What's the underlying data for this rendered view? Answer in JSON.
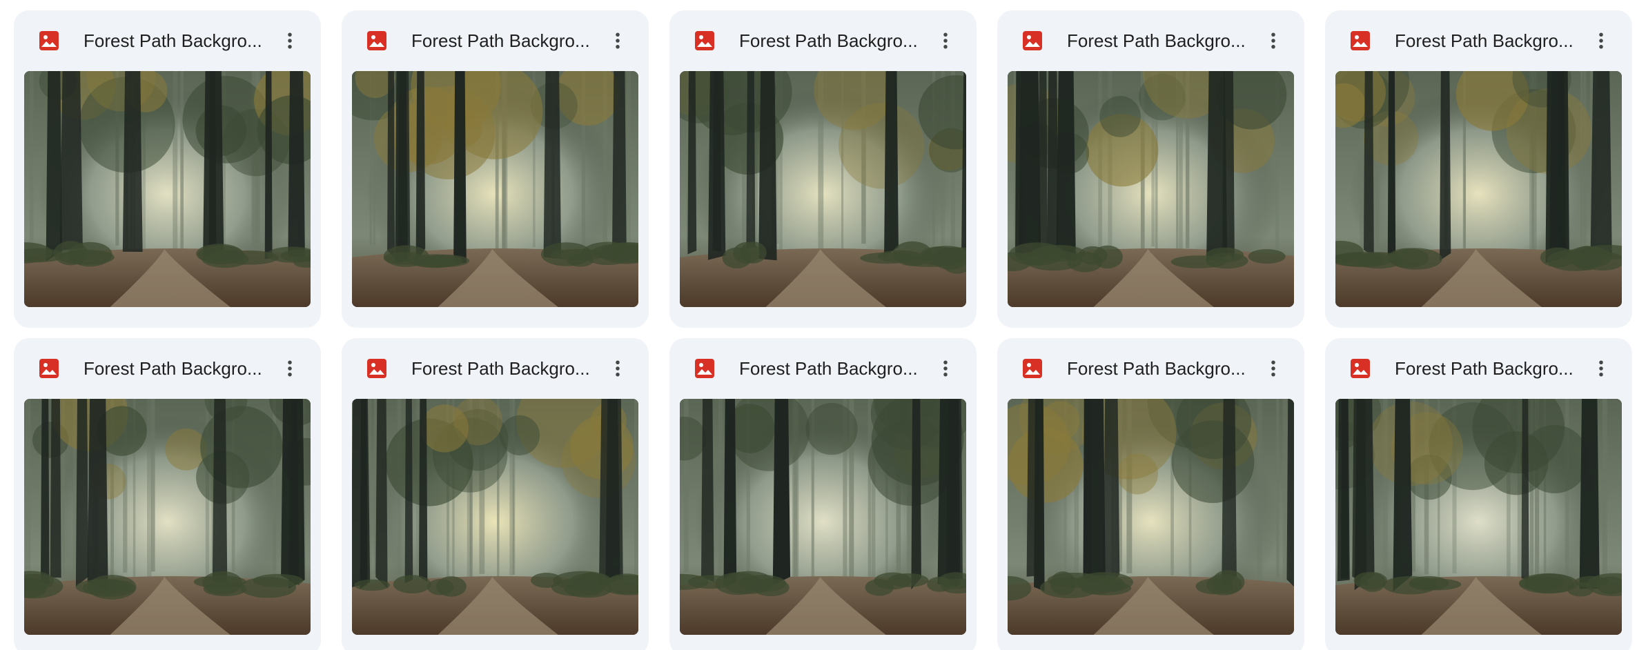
{
  "files": [
    {
      "title": "Forest Path Backgro...",
      "icon": "image-file-icon",
      "variant": 0
    },
    {
      "title": "Forest Path Backgro...",
      "icon": "image-file-icon",
      "variant": 1
    },
    {
      "title": "Forest Path Backgro...",
      "icon": "image-file-icon",
      "variant": 2
    },
    {
      "title": "Forest Path Backgro...",
      "icon": "image-file-icon",
      "variant": 3
    },
    {
      "title": "Forest Path Backgro...",
      "icon": "image-file-icon",
      "variant": 4
    },
    {
      "title": "Forest Path Backgro...",
      "icon": "image-file-icon",
      "variant": 5
    },
    {
      "title": "Forest Path Backgro...",
      "icon": "image-file-icon",
      "variant": 6
    },
    {
      "title": "Forest Path Backgro...",
      "icon": "image-file-icon",
      "variant": 7
    },
    {
      "title": "Forest Path Backgro...",
      "icon": "image-file-icon",
      "variant": 8
    },
    {
      "title": "Forest Path Backgro...",
      "icon": "image-file-icon",
      "variant": 9
    }
  ],
  "more_icon": "more-vert-icon",
  "colors": {
    "card_bg": "#f0f4f9",
    "icon_red": "#d93025",
    "title_text": "#1f1f1f",
    "more_icon": "#444746"
  }
}
